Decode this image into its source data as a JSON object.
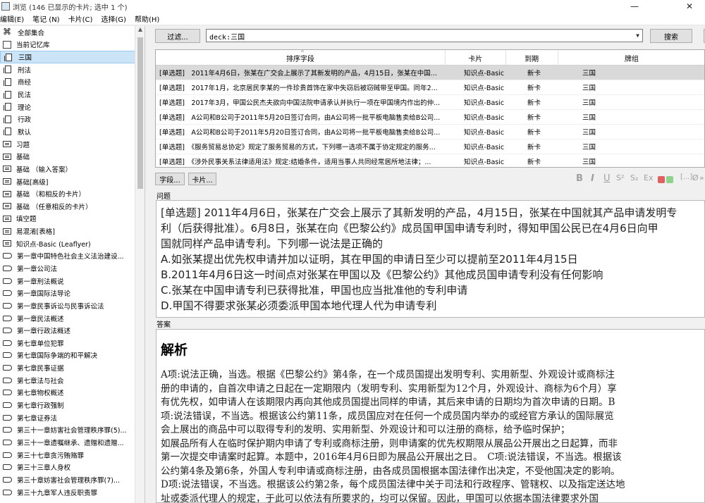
{
  "window": {
    "title": "浏览 (146 已显示的卡片; 选中 1 个)",
    "minimize": "—",
    "close": "✕"
  },
  "menu": [
    "编辑(E)",
    "笔记 (N)",
    "卡片(C)",
    "选择(G)",
    "帮助(H)"
  ],
  "sidebar": {
    "items": [
      {
        "label": "全部集合",
        "icon": "all-collection-icon"
      },
      {
        "label": "当前记忆库",
        "icon": "current-deck-icon"
      },
      {
        "label": "三国",
        "icon": "deck-icon",
        "selected": true
      },
      {
        "label": "刑法",
        "icon": "deck-icon"
      },
      {
        "label": "商经",
        "icon": "deck-icon"
      },
      {
        "label": "民法",
        "icon": "deck-icon"
      },
      {
        "label": "理论",
        "icon": "deck-icon"
      },
      {
        "label": "行政",
        "icon": "deck-icon"
      },
      {
        "label": "默认",
        "icon": "deck-icon"
      },
      {
        "label": "习题",
        "icon": "note-type-icon"
      },
      {
        "label": "基础",
        "icon": "note-type-icon"
      },
      {
        "label": "基础 （输入答案）",
        "icon": "note-type-icon"
      },
      {
        "label": "基础[高级]",
        "icon": "note-type-icon"
      },
      {
        "label": "基础 （和相反的卡片）",
        "icon": "note-type-icon"
      },
      {
        "label": "基础 （任意相反的卡片）",
        "icon": "note-type-icon"
      },
      {
        "label": "填空题",
        "icon": "note-type-icon"
      },
      {
        "label": "易混淆[表格]",
        "icon": "note-type-icon"
      },
      {
        "label": "知识点-Basic (Leaflyer)",
        "icon": "note-type-icon"
      },
      {
        "label": "第一章中国特色社会主义法治建设...",
        "icon": "tag-icon"
      },
      {
        "label": "第一章公司法",
        "icon": "tag-icon"
      },
      {
        "label": "第一章刑法概说",
        "icon": "tag-icon"
      },
      {
        "label": "第一章国际法导论",
        "icon": "tag-icon"
      },
      {
        "label": "第一章民事诉讼与民事诉讼法",
        "icon": "tag-icon"
      },
      {
        "label": "第一章民法概述",
        "icon": "tag-icon"
      },
      {
        "label": "第一章行政法概述",
        "icon": "tag-icon"
      },
      {
        "label": "第七章单位犯罪",
        "icon": "tag-icon"
      },
      {
        "label": "第七章国际争端的和平解决",
        "icon": "tag-icon"
      },
      {
        "label": "第七章民事证据",
        "icon": "tag-icon"
      },
      {
        "label": "第七章法与社会",
        "icon": "tag-icon"
      },
      {
        "label": "第七章物权概述",
        "icon": "tag-icon"
      },
      {
        "label": "第七章行政强制",
        "icon": "tag-icon"
      },
      {
        "label": "第七章证券法",
        "icon": "tag-icon"
      },
      {
        "label": "第三十一章妨害社会管理秩序罪(5)...",
        "icon": "tag-icon"
      },
      {
        "label": "第三十一章遗嘱继承、遗赠和遗赠...",
        "icon": "tag-icon"
      },
      {
        "label": "第三十七章贪污贿赂罪",
        "icon": "tag-icon"
      },
      {
        "label": "第三十三章人身权",
        "icon": "tag-icon"
      },
      {
        "label": "第三十章妨害社会管理秩序罪(7)...",
        "icon": "tag-icon"
      },
      {
        "label": "第三十九章军人违反职责罪",
        "icon": "tag-icon"
      }
    ]
  },
  "toolbar": {
    "filter_label": "过滤...",
    "search_value": "deck:三国",
    "search_button": "搜索"
  },
  "table": {
    "columns": [
      "排序字段",
      "卡片",
      "到期",
      "牌组"
    ],
    "rows": [
      {
        "sort": "[单选题]　2011年4月6日，张某在广交会上展示了其新发明的产品，4月15日，张某在中国...",
        "card": "知识点-Basic",
        "due": "新卡",
        "deck": "三国",
        "selected": true
      },
      {
        "sort": "[单选题]　2017年1月，北京居民李某的一件珍贵首饰在家中失窃后被窃贼带至甲国。同年2...",
        "card": "知识点-Basic",
        "due": "新卡",
        "deck": "三国"
      },
      {
        "sort": "[单选题]　2017年3月，甲国公民杰夫欲向中国法院申请承认并执行一项在甲国境内作出的仲...",
        "card": "知识点-Basic",
        "due": "新卡",
        "deck": "三国"
      },
      {
        "sort": "[单选题]　A公司和B公司于2011年5月20日签订合同，由A公司将一批平板电脑售卖给B公司...",
        "card": "知识点-Basic",
        "due": "新卡",
        "deck": "三国"
      },
      {
        "sort": "[单选题]　A公司和B公司于2011年5月20日签订合同，由A公司将一批平板电脑售卖给B公司...",
        "card": "知识点-Basic",
        "due": "新卡",
        "deck": "三国"
      },
      {
        "sort": "[单选题]　《服务贸易总协定》规定了服务贸易的方式，下列哪一选项不属于协定规定的服务...",
        "card": "知识点-Basic",
        "due": "新卡",
        "deck": "三国"
      },
      {
        "sort": "[单选题]　《涉外民事关系法律适用法》规定:结婚条件，适用当事人共同经常居所地法律；...",
        "card": "知识点-Basic",
        "due": "新卡",
        "deck": "三国"
      }
    ]
  },
  "editor": {
    "fields_button": "字段...",
    "cards_button": "卡片...",
    "format_icons": [
      "B",
      "I",
      "U",
      "S²",
      "S₂",
      "Ex",
      "[...]",
      "Ø",
      "»"
    ],
    "colors": {
      "text_color": "#e06060",
      "highlight": "#8cd48c"
    },
    "question_label": "问题",
    "question_lines": [
      "[单选题] 2011年4月6日，张某在广交会上展示了其新发明的产品，4月15日，张某在中国就其产品申请发明专",
      "利（后获得批准）。6月8日，张某在向《巴黎公约》成员国甲国申请专利时，得知甲国公民已在4月6日向甲",
      "国就同样产品申请专利。下列哪一说法是正确的",
      "A.如张某提出优先权申请并加以证明，其在甲国的申请日至少可以提前至2011年4月15日",
      "B.2011年4月6日这一时间点对张某在甲国以及《巴黎公约》其他成员国申请专利没有任何影响",
      "C.张某在中国申请专利已获得批准，甲国也应当批准他的专利申请",
      "D.甲国不得要求张某必须委派甲国本地代理人代为申请专利"
    ],
    "answer_label": "答案",
    "answer_title": "解析",
    "answer_lines": [
      "A项:说法正确，当选。根据《巴黎公约》第4条，在一个成员国提出发明专利、实用新型、外观设计或商标注",
      "册的申请的，自首次申请之日起在一定期限内（发明专利、实用新型为12个月，外观设计、商标为6个月）享",
      "有优先权，如申请人在该期限内再向其他成员国提出同样的申请，其后来申请的日期均为首次申请的日期。B",
      "项:说法错误，不当选。根据该公约第11条，成员国应对在任何一个成员国内举办的或经官方承认的国际展览",
      "会上展出的商品中可以取得专利的发明、实用新型、外观设计和可以注册的商标，给予临时保护；",
      "如展品所有人在临时保护期内申请了专利或商标注册，则申请案的优先权期限从展品公开展出之日起算，而非",
      "第一次提交申请案时起算。本题中，2016年4月6日即为展品公开展出之日。　C项:说法错误，不当选。根据该",
      "公约第4条及第6条，外国人专利申请或商标注册，由各成员国根据本国法律作出决定，不受他国决定的影响。",
      "D项:说法错误，不当选。根据该公约第2条，每个成员国法律中关于司法和行政程序、管辖权、以及指定送达地",
      "址或委派代理人的规定，于此可以依法有所要求的，均可以保留。因此，甲国可以依据本国法律要求外国"
    ]
  }
}
